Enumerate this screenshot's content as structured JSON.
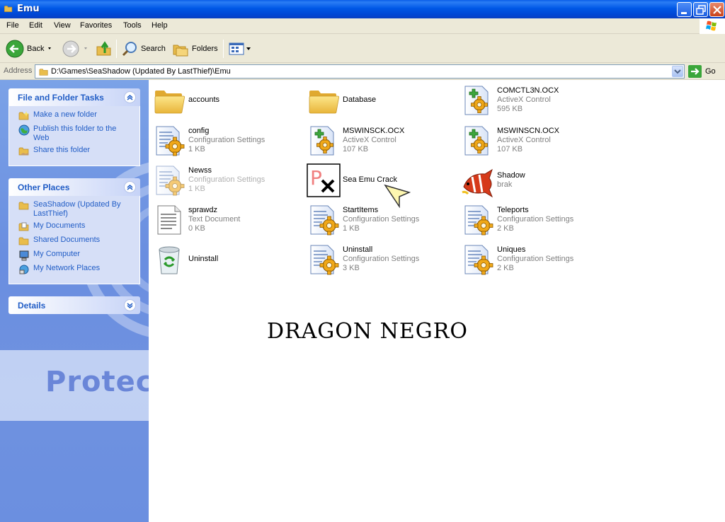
{
  "window": {
    "title": "Emu"
  },
  "menu": [
    "File",
    "Edit",
    "View",
    "Favorites",
    "Tools",
    "Help"
  ],
  "toolbar": {
    "back": "Back",
    "search": "Search",
    "folders": "Folders"
  },
  "address": {
    "label": "Address",
    "path": "D:\\Games\\SeaShadow (Updated By LastThief)\\Emu",
    "go": "Go"
  },
  "left": {
    "tasks": {
      "title": "File and Folder Tasks",
      "items": [
        "Make a new folder",
        "Publish this folder to the Web",
        "Share this folder"
      ]
    },
    "places": {
      "title": "Other Places",
      "items": [
        "SeaShadow (Updated By LastThief)",
        "My Documents",
        "Shared Documents",
        "My Computer",
        "My Network Places"
      ]
    },
    "details": {
      "title": "Details"
    },
    "background_text": "Protec"
  },
  "files": [
    {
      "name": "accounts",
      "type": "",
      "size": "",
      "icon": "folder-icon"
    },
    {
      "name": "Database",
      "type": "",
      "size": "",
      "icon": "folder-icon"
    },
    {
      "name": "COMCTL3N.OCX",
      "type": "ActiveX Control",
      "size": "595 KB",
      "icon": "activex-icon"
    },
    {
      "name": "config",
      "type": "Configuration Settings",
      "size": "1 KB",
      "icon": "settings-icon"
    },
    {
      "name": "MSWINSCK.OCX",
      "type": "ActiveX Control",
      "size": "107 KB",
      "icon": "activex-icon"
    },
    {
      "name": "MSWINSCN.OCX",
      "type": "ActiveX Control",
      "size": "107 KB",
      "icon": "activex-icon"
    },
    {
      "name": "Newss",
      "type": "Configuration Settings",
      "size": "1 KB",
      "icon": "settings-icon"
    },
    {
      "name": "Sea Emu Crack",
      "type": "",
      "size": "",
      "icon": "crack-app-icon"
    },
    {
      "name": "Shadow",
      "type": "brak",
      "size": "",
      "icon": "fish-icon"
    },
    {
      "name": "sprawdz",
      "type": "Text Document",
      "size": "0 KB",
      "icon": "text-document-icon"
    },
    {
      "name": "StartItems",
      "type": "Configuration Settings",
      "size": "1 KB",
      "icon": "settings-icon"
    },
    {
      "name": "Teleports",
      "type": "Configuration Settings",
      "size": "2 KB",
      "icon": "settings-icon"
    },
    {
      "name": "Uninstall",
      "type": "",
      "size": "",
      "icon": "uninstall-icon"
    },
    {
      "name": "Uninstall",
      "type": "Configuration Settings",
      "size": "3 KB",
      "icon": "settings-icon"
    },
    {
      "name": "Uniques",
      "type": "Configuration Settings",
      "size": "2 KB",
      "icon": "settings-icon"
    }
  ],
  "watermark": "DRAGON NEGRO",
  "colors": {
    "title_bar": "#0058e6",
    "task_pane": "#6f92e0",
    "link": "#215dc6"
  }
}
